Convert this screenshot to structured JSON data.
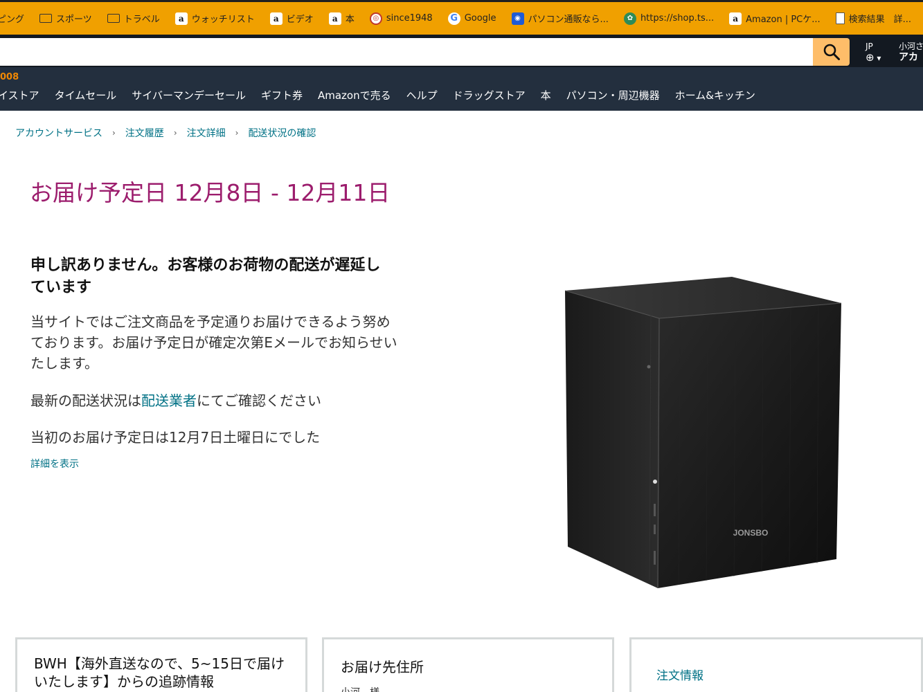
{
  "bookmarks": [
    {
      "label": "ピング",
      "icon": "none"
    },
    {
      "label": "スポーツ",
      "icon": "folder-icon"
    },
    {
      "label": "トラベル",
      "icon": "folder-icon"
    },
    {
      "label": "ウォッチリスト",
      "icon": "amazon-icon"
    },
    {
      "label": "ビデオ",
      "icon": "amazon-icon"
    },
    {
      "label": "本",
      "icon": "amazon-icon"
    },
    {
      "label": "since1948",
      "icon": "red-circle-icon"
    },
    {
      "label": "Google",
      "icon": "google-icon"
    },
    {
      "label": "パソコン通販なら...",
      "icon": "blue-square-icon"
    },
    {
      "label": "https://shop.ts...",
      "icon": "green-badge-icon"
    },
    {
      "label": "Amazon | PCケ...",
      "icon": "amazon-icon"
    },
    {
      "label": "検索結果　詳...",
      "icon": "document-icon"
    }
  ],
  "header": {
    "search_value": "",
    "lang_code": "JP",
    "account_greeting": "小河さ",
    "account_label": "アカ"
  },
  "nav": {
    "top_text": "008",
    "links": [
      "イストア",
      "タイムセール",
      "サイバーマンデーセール",
      "ギフト券",
      "Amazonで売る",
      "ヘルプ",
      "ドラッグストア",
      "本",
      "パソコン・周辺機器",
      "ホーム&キッチン"
    ]
  },
  "breadcrumb": [
    "アカウントサービス",
    "注文履歴",
    "注文詳細",
    "配送状況の確認"
  ],
  "main": {
    "delivery_title": "お届け予定日 12月8日 - 12月11日",
    "delay_heading": "申し訳ありません。お客様のお荷物の配送が遅延しています",
    "delay_body": "当サイトではご注文商品を予定通りお届けできるよう努めております。お届け予定日が確定次第Eメールでお知らせいたします。",
    "latest_prefix": "最新の配送状況は",
    "latest_link": "配送業者",
    "latest_suffix": "にてご確認ください",
    "original_date": "当初のお届け予定日は12月7日土曜日にでした",
    "details_link": "詳細を表示"
  },
  "product": {
    "brand_text": "JONSBO"
  },
  "boxes": {
    "tracking_title": "BWH【海外直送なので、5~15日で届けいたします】からの追跡情報",
    "address_title": "お届け先住所",
    "address_sub": "小河　様",
    "order_info_link": "注文情報"
  },
  "colors": {
    "bookmark_bar": "#f0a000",
    "header_dark": "#131921",
    "nav_dark": "#232f3e",
    "search_button": "#febd69",
    "title_magenta": "#9c1d6d",
    "link_teal": "#007185"
  }
}
